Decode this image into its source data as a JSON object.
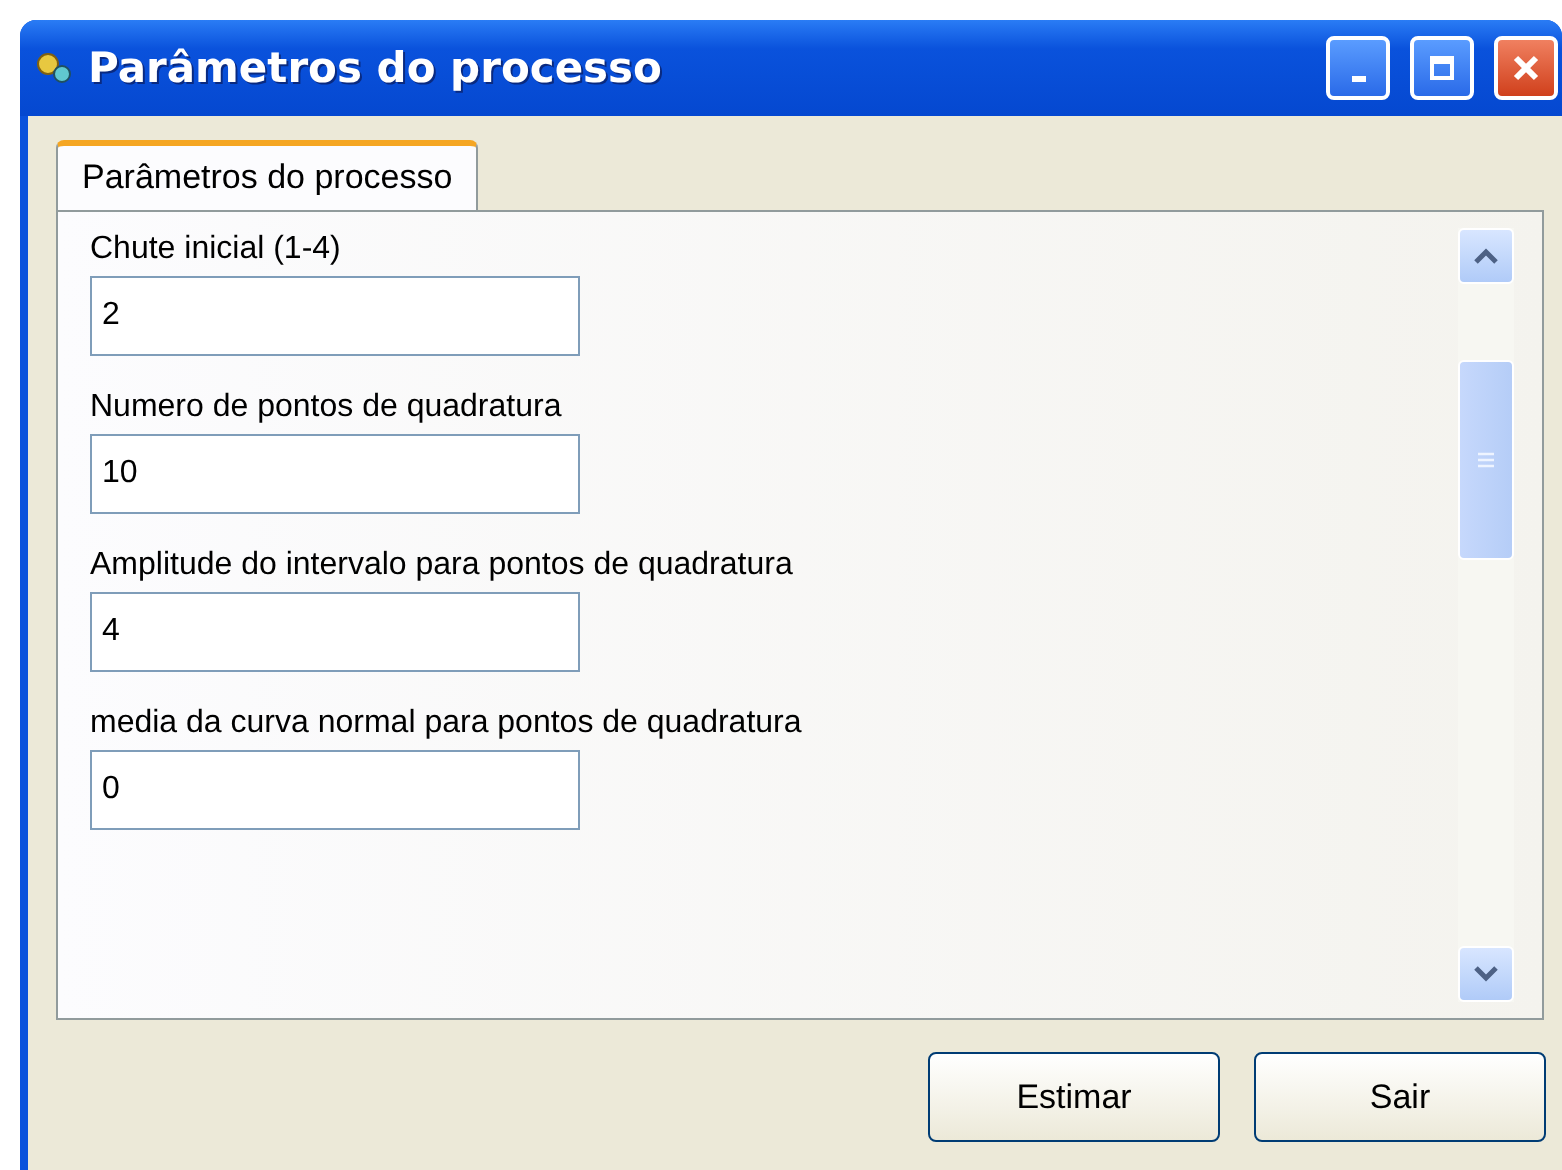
{
  "window": {
    "title": "Parâmetros do processo"
  },
  "tabs": [
    {
      "label": "Parâmetros do processo",
      "selected": true
    }
  ],
  "fields": [
    {
      "label": "Chute inicial (1-4)",
      "value": "2"
    },
    {
      "label": "Numero de pontos de quadratura",
      "value": "10"
    },
    {
      "label": "Amplitude do intervalo para pontos de quadratura",
      "value": "4"
    },
    {
      "label": "media da curva normal para pontos de quadratura",
      "value": "0"
    }
  ],
  "buttons": [
    "Estimar",
    "Sair"
  ]
}
